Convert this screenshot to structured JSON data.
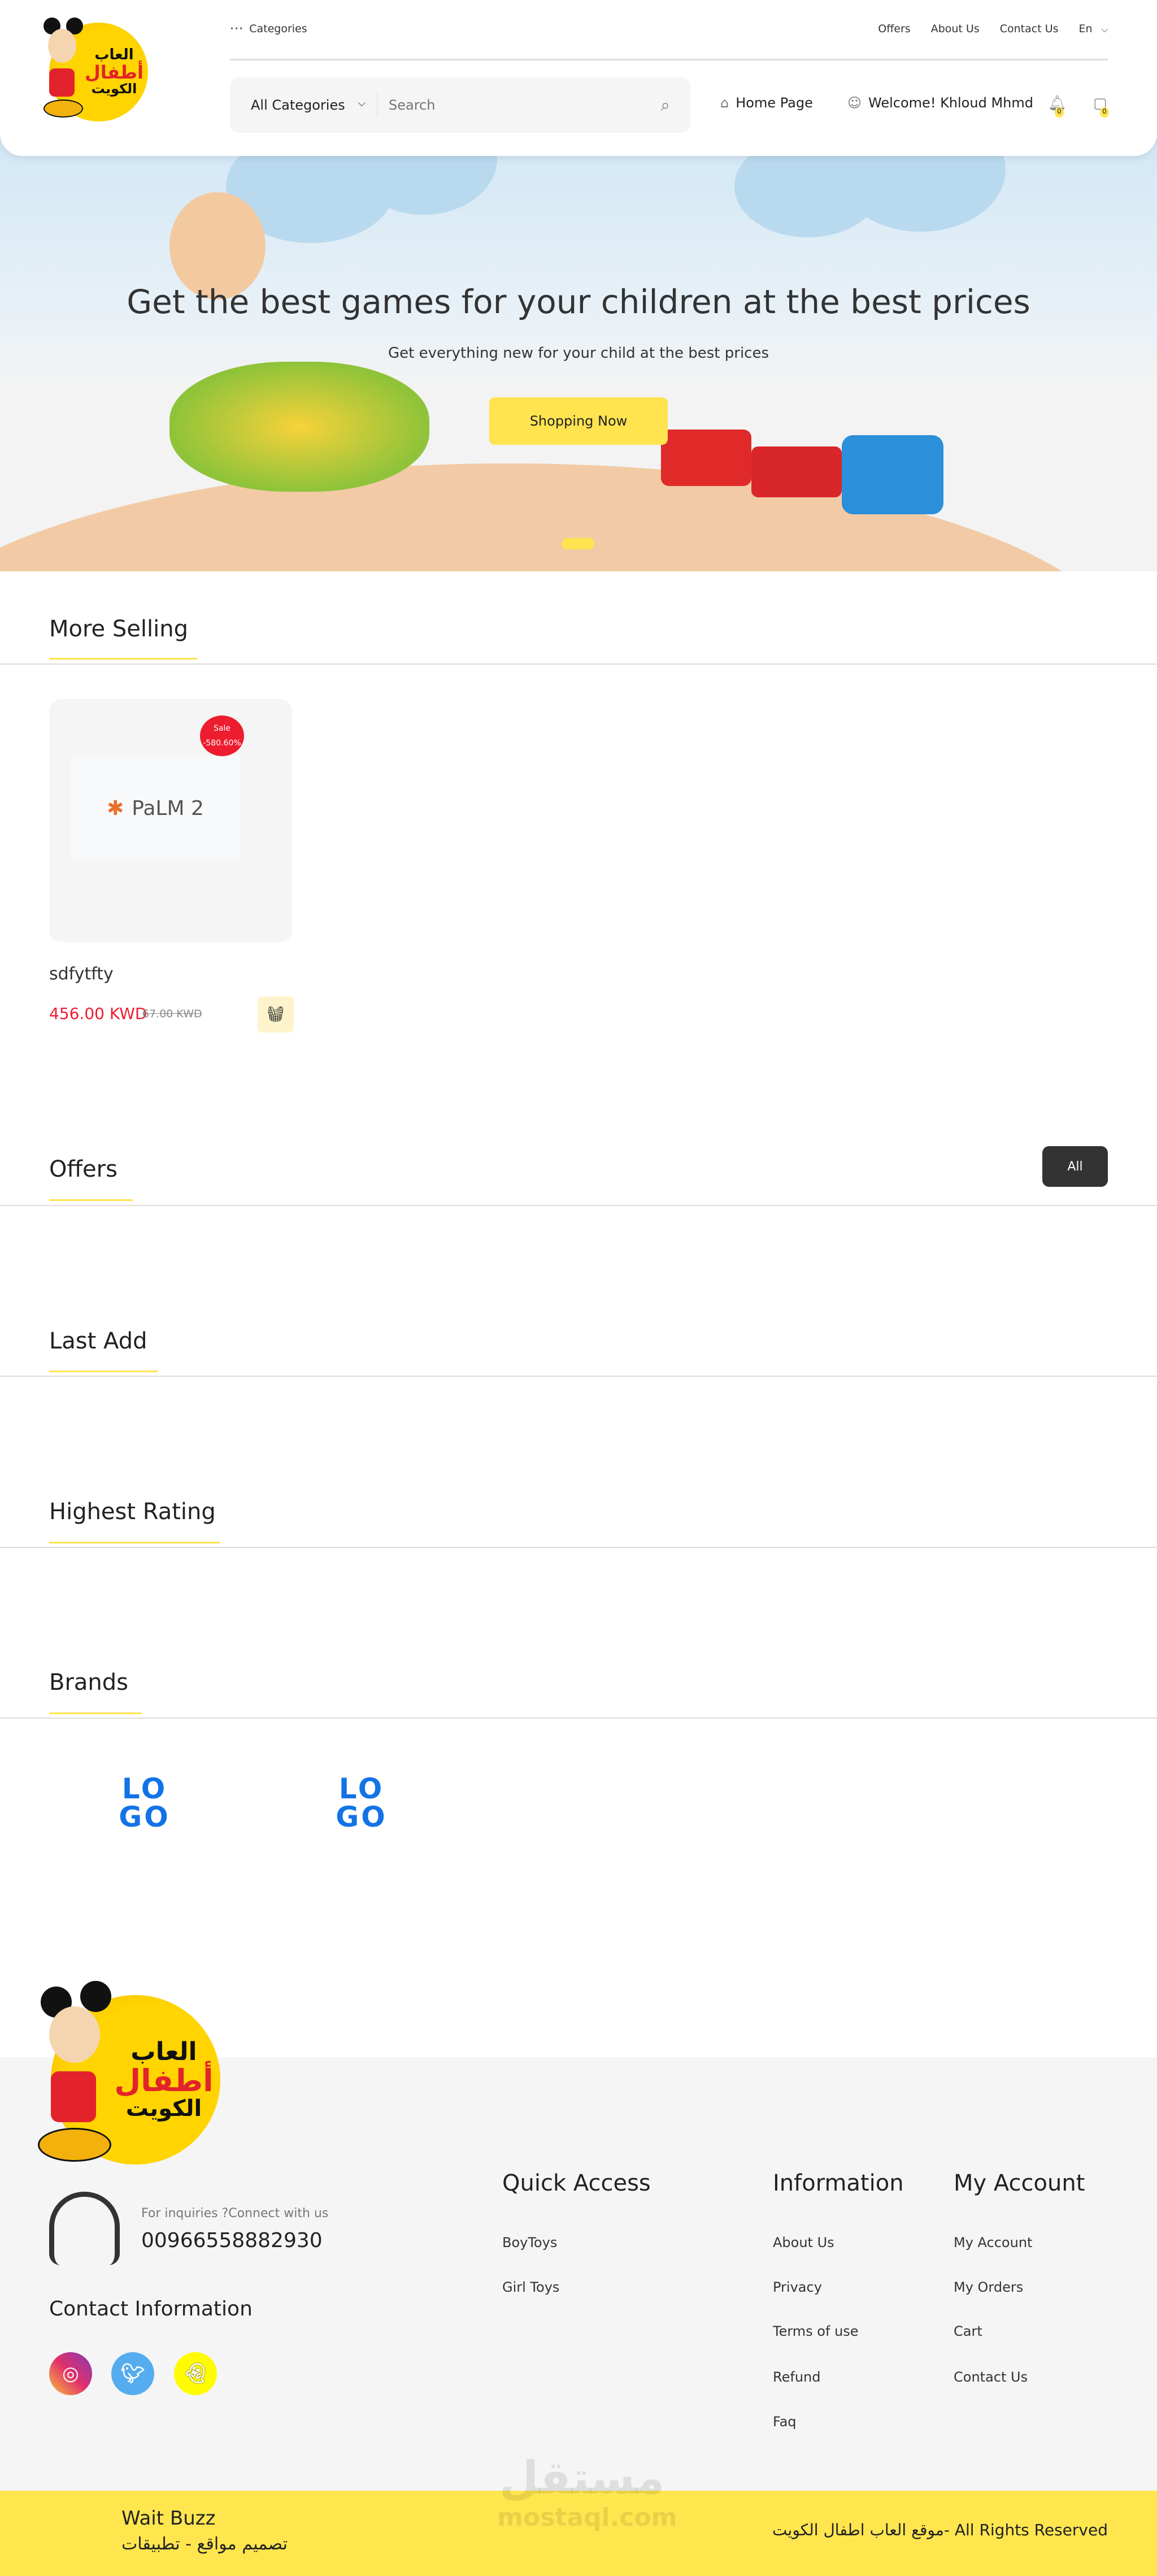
{
  "logo": {
    "line1": "العاب",
    "line2": "أطفال",
    "line3": "الكويت"
  },
  "topbar": {
    "categories": "Categories",
    "links": [
      "Offers",
      "About Us",
      "Contact Us"
    ],
    "language": "En"
  },
  "search": {
    "category": "All Categories",
    "placeholder": "Search"
  },
  "nav": {
    "home": "Home Page",
    "welcome": "Welcome! Khloud Mhmd",
    "notifications_count": "0",
    "cart_count": "0"
  },
  "hero": {
    "title": "Get the best games for your children at the best prices",
    "subtitle": "Get everything new for your child at the best prices",
    "button": "Shopping Now",
    "slides": 1,
    "active_slide": 1
  },
  "sections": {
    "more_selling": "More Selling",
    "offers": "Offers",
    "offers_all": "All",
    "last_add": "Last Add",
    "highest_rating": "Highest Rating",
    "brands": "Brands"
  },
  "product": {
    "name": "sdfytfty",
    "price": "456.00 KWD",
    "old_price": "67.00 KWD",
    "badge_label": "Sale",
    "badge_discount": "-580.60%",
    "image_text": "PaLM 2"
  },
  "brands": [
    {
      "line1": "LO",
      "line2": "GO"
    },
    {
      "line1": "LO",
      "line2": "GO"
    }
  ],
  "footer": {
    "inquiries": "For inquiries ?Connect with us",
    "phone": "00966558882930",
    "contact_title": "Contact Information",
    "socials": [
      "instagram",
      "twitter",
      "snapchat"
    ],
    "columns": [
      {
        "title": "Quick Access",
        "links": [
          "BoyToys",
          "Girl Toys"
        ]
      },
      {
        "title": "Information",
        "links": [
          "About Us",
          "Privacy",
          "Terms of use",
          "Refund",
          "Faq"
        ]
      },
      {
        "title": "My Account",
        "links": [
          "My Account",
          "My Orders",
          "Cart",
          "Contact Us"
        ]
      }
    ],
    "credit_name": "Wait Buzz",
    "credit_sub": "تصميم مواقع - تطبيقات",
    "rights": "موقع العاب اطفال الكويت- All Rights Reserved",
    "watermark": "مستقل",
    "watermark_sub": "mostaql.com"
  },
  "colors": {
    "accent": "#ffe34f",
    "sale": "#ed1c2e",
    "footer_bg": "#f5f5f5",
    "dark_button": "#333333"
  }
}
